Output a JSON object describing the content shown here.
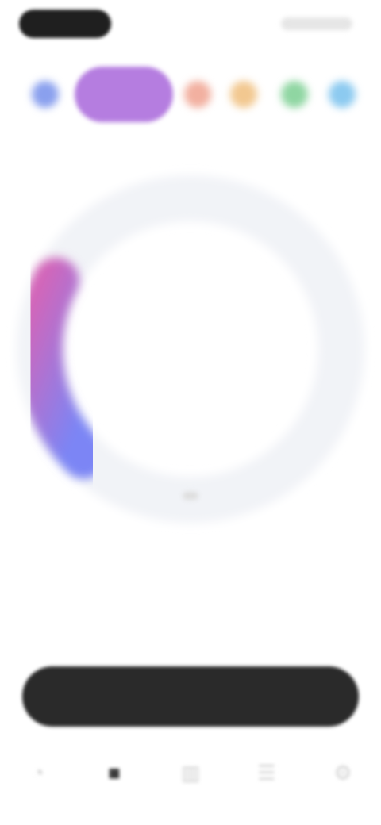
{
  "status_bar": {
    "time": "",
    "indicators": ""
  },
  "timer_tabs": [
    {
      "color": "#8aa0ee",
      "active": false
    },
    {
      "color": "#b57de0",
      "active": true
    },
    {
      "color": "#f2b0a0",
      "active": false
    },
    {
      "color": "#f2c890",
      "active": false
    },
    {
      "color": "#8fd6a2",
      "active": false
    },
    {
      "color": "#8ccaf0",
      "active": false
    }
  ],
  "dial": {
    "caption": "",
    "time": "",
    "progress": 0.2,
    "gradient_start": "#d465b8",
    "gradient_end": "#7b85f5",
    "track_color": "#f1f3f7"
  },
  "stats": [
    {
      "label": "",
      "value": ""
    },
    {
      "label": "",
      "value": ""
    }
  ],
  "primary_button": {
    "label": ""
  },
  "bottom_nav": [
    {
      "icon": "timer-icon",
      "glyph": "◔",
      "active": false
    },
    {
      "icon": "hourglass-icon",
      "glyph": "■",
      "active": true
    },
    {
      "icon": "chart-icon",
      "glyph": "▥",
      "active": false
    },
    {
      "icon": "list-icon",
      "glyph": "☰",
      "active": false
    },
    {
      "icon": "gear-icon",
      "glyph": "⚙",
      "active": false
    }
  ]
}
